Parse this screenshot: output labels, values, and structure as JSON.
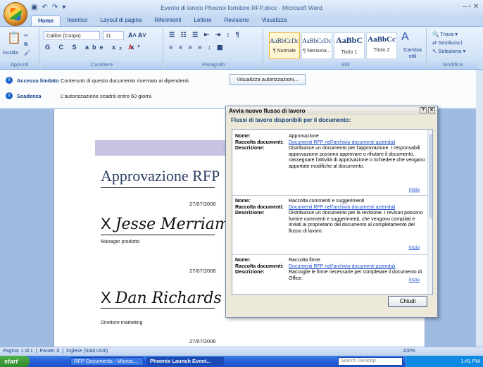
{
  "window": {
    "title": "Evento di lancio Phoenix fornitore RFP.docx - Microsoft Word"
  },
  "tabs": [
    "Home",
    "Inserisci",
    "Layout di pagina",
    "Riferimenti",
    "Lettere",
    "Revisione",
    "Visualizza"
  ],
  "ribbon": {
    "clipboard_label": "Appunti",
    "paste_label": "Incolla",
    "font_label": "Carattere",
    "font_name": "Calibri (Corpo)",
    "font_size": "11",
    "paragraph_label": "Paragrafo",
    "styles_label": "Stili",
    "edit_label": "Modifica",
    "styles": [
      {
        "sample": "AaBbCcDc",
        "name": "¶ Normale"
      },
      {
        "sample": "AaBbCcDc",
        "name": "¶ Nessuna..."
      },
      {
        "sample": "AaBbC",
        "name": "Titolo 1"
      },
      {
        "sample": "AaBbCc",
        "name": "Titolo 2"
      }
    ],
    "change_styles": "Cambia stili",
    "find": "Trova",
    "replace": "Sostituisci",
    "select": "Seleziona"
  },
  "messagebar": {
    "rows": [
      {
        "key": "Accesso limitato",
        "text": "Contenuto di questo documento riservato ai dipendenti"
      },
      {
        "key": "Scadenza",
        "text": "L'autorizzazione scadrà entro 60 giorni."
      }
    ],
    "button": "Visualizza autorizzazioni..."
  },
  "document": {
    "title": "Approvazione RFP",
    "date1": "27/07/2006",
    "sig1": "Jesse Merriam",
    "role1": "Manager prodotto",
    "date2": "27/07/2006",
    "sig2": "Dan Richards",
    "role2": "Direttore marketing",
    "date3": "27/07/2006"
  },
  "dialog": {
    "title": "Avvia nuovo flusso di lavoro",
    "header": "Flussi di lavoro disponibili per il documento:",
    "labels": {
      "name": "Nome:",
      "library": "Raccolta documenti:",
      "desc": "Descrizione:"
    },
    "start_link": "Inizio",
    "workflows": [
      {
        "name": "Approvazione",
        "library": "Documenti RFP nell'archivio documenti aziendali",
        "desc": "Distribuisce un documento per l'approvazione. I responsabili approvazione possono approvare o rifiutare il documento, riassegnare l'attività di approvazione o richiedere che vengano apportate modifiche al documento."
      },
      {
        "name": "Raccolta commenti e suggerimenti",
        "library": "Documenti RFP nell'archivio documenti aziendali",
        "desc": "Distribuisce un documento per la revisione. I revisori possono fornire commenti e suggerimenti, che vengono compilati e inviati al proprietario del documento al completamento del flusso di lavoro."
      },
      {
        "name": "Raccolta firme",
        "library": "Documenti RFP nell'archivio documenti aziendali",
        "desc": "Raccoglie le firme necessarie per completare il documento di Office."
      }
    ],
    "close": "Chiudi"
  },
  "status": {
    "page": "Pagina: 1 di 1",
    "words": "Parole: 0",
    "lang": "Inglese (Stati Uniti)",
    "zoom": "100%"
  },
  "taskbar": {
    "start": "start",
    "tasks": [
      "RFP Documents - Micros...",
      "Phoenix Launch Event..."
    ],
    "search": "Search Desktop",
    "clock": "1:41 PM"
  }
}
